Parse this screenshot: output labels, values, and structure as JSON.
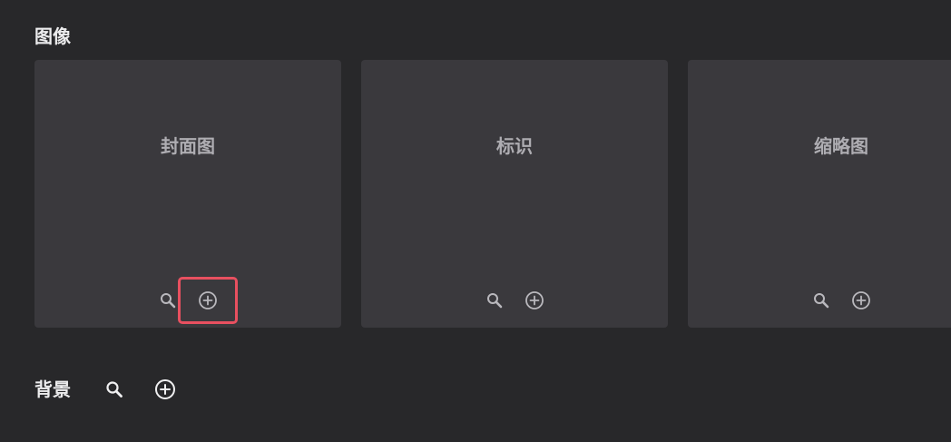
{
  "images_section": {
    "title": "图像",
    "tiles": [
      {
        "label": "封面图",
        "search_icon": "search-icon",
        "add_icon": "add-circle-icon",
        "add_highlighted": true
      },
      {
        "label": "标识",
        "search_icon": "search-icon",
        "add_icon": "add-circle-icon",
        "add_highlighted": false
      },
      {
        "label": "缩略图",
        "search_icon": "search-icon",
        "add_icon": "add-circle-icon",
        "add_highlighted": false
      }
    ]
  },
  "background_section": {
    "title": "背景",
    "search_icon": "search-icon",
    "add_icon": "add-circle-icon"
  },
  "colors": {
    "background": "#28282a",
    "tile": "#3a393d",
    "tile_text": "#aeadb2",
    "tile_icon": "#b9b8bd",
    "title_text": "#ececed",
    "highlight": "#e85060"
  }
}
